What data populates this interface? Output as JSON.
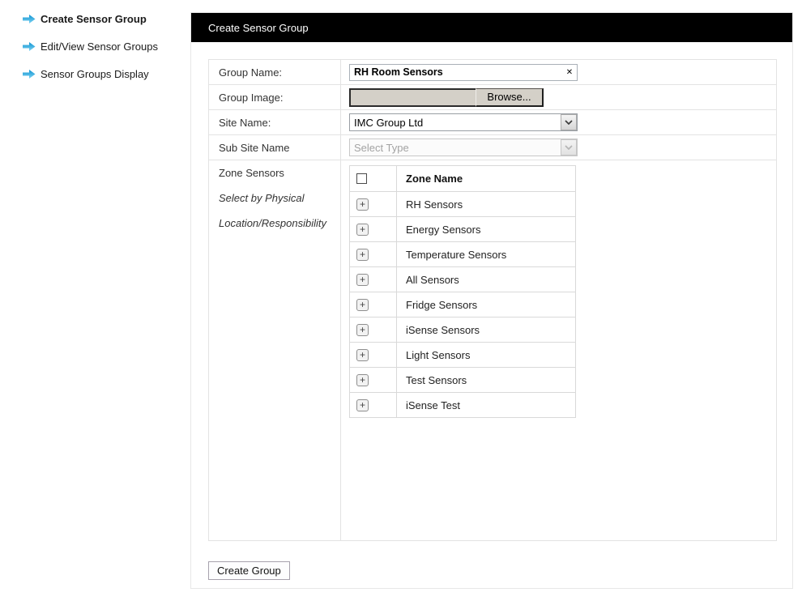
{
  "sidebar": {
    "items": [
      {
        "label": "Create Sensor Group",
        "active": true
      },
      {
        "label": "Edit/View Sensor Groups",
        "active": false
      },
      {
        "label": "Sensor Groups Display",
        "active": false
      }
    ]
  },
  "panel": {
    "title": "Create Sensor Group"
  },
  "form": {
    "group_name": {
      "label": "Group Name:",
      "value": "RH Room Sensors"
    },
    "group_image": {
      "label": "Group Image:",
      "browse_label": "Browse..."
    },
    "site_name": {
      "label": "Site Name:",
      "selected": "IMC Group Ltd"
    },
    "sub_site_name": {
      "label": "Sub Site Name",
      "selected": "Select Type",
      "disabled": true
    },
    "zone_sensors": {
      "label": "Zone Sensors",
      "hint_line1": "Select by Physical",
      "hint_line2": "Location/Responsibility",
      "table": {
        "header": "Zone Name",
        "rows": [
          "RH Sensors",
          "Energy Sensors",
          "Temperature Sensors",
          "All Sensors",
          "Fridge Sensors",
          "iSense Sensors",
          "Light Sensors",
          "Test Sensors",
          "iSense Test"
        ]
      }
    }
  },
  "actions": {
    "create_group_label": "Create Group"
  },
  "icons": {
    "expand_glyph": "+",
    "clear_glyph": "✕"
  },
  "colors": {
    "header_bg": "#000000",
    "arrow_top": "#0f93d2",
    "arrow_bottom": "#7dd3f3"
  }
}
